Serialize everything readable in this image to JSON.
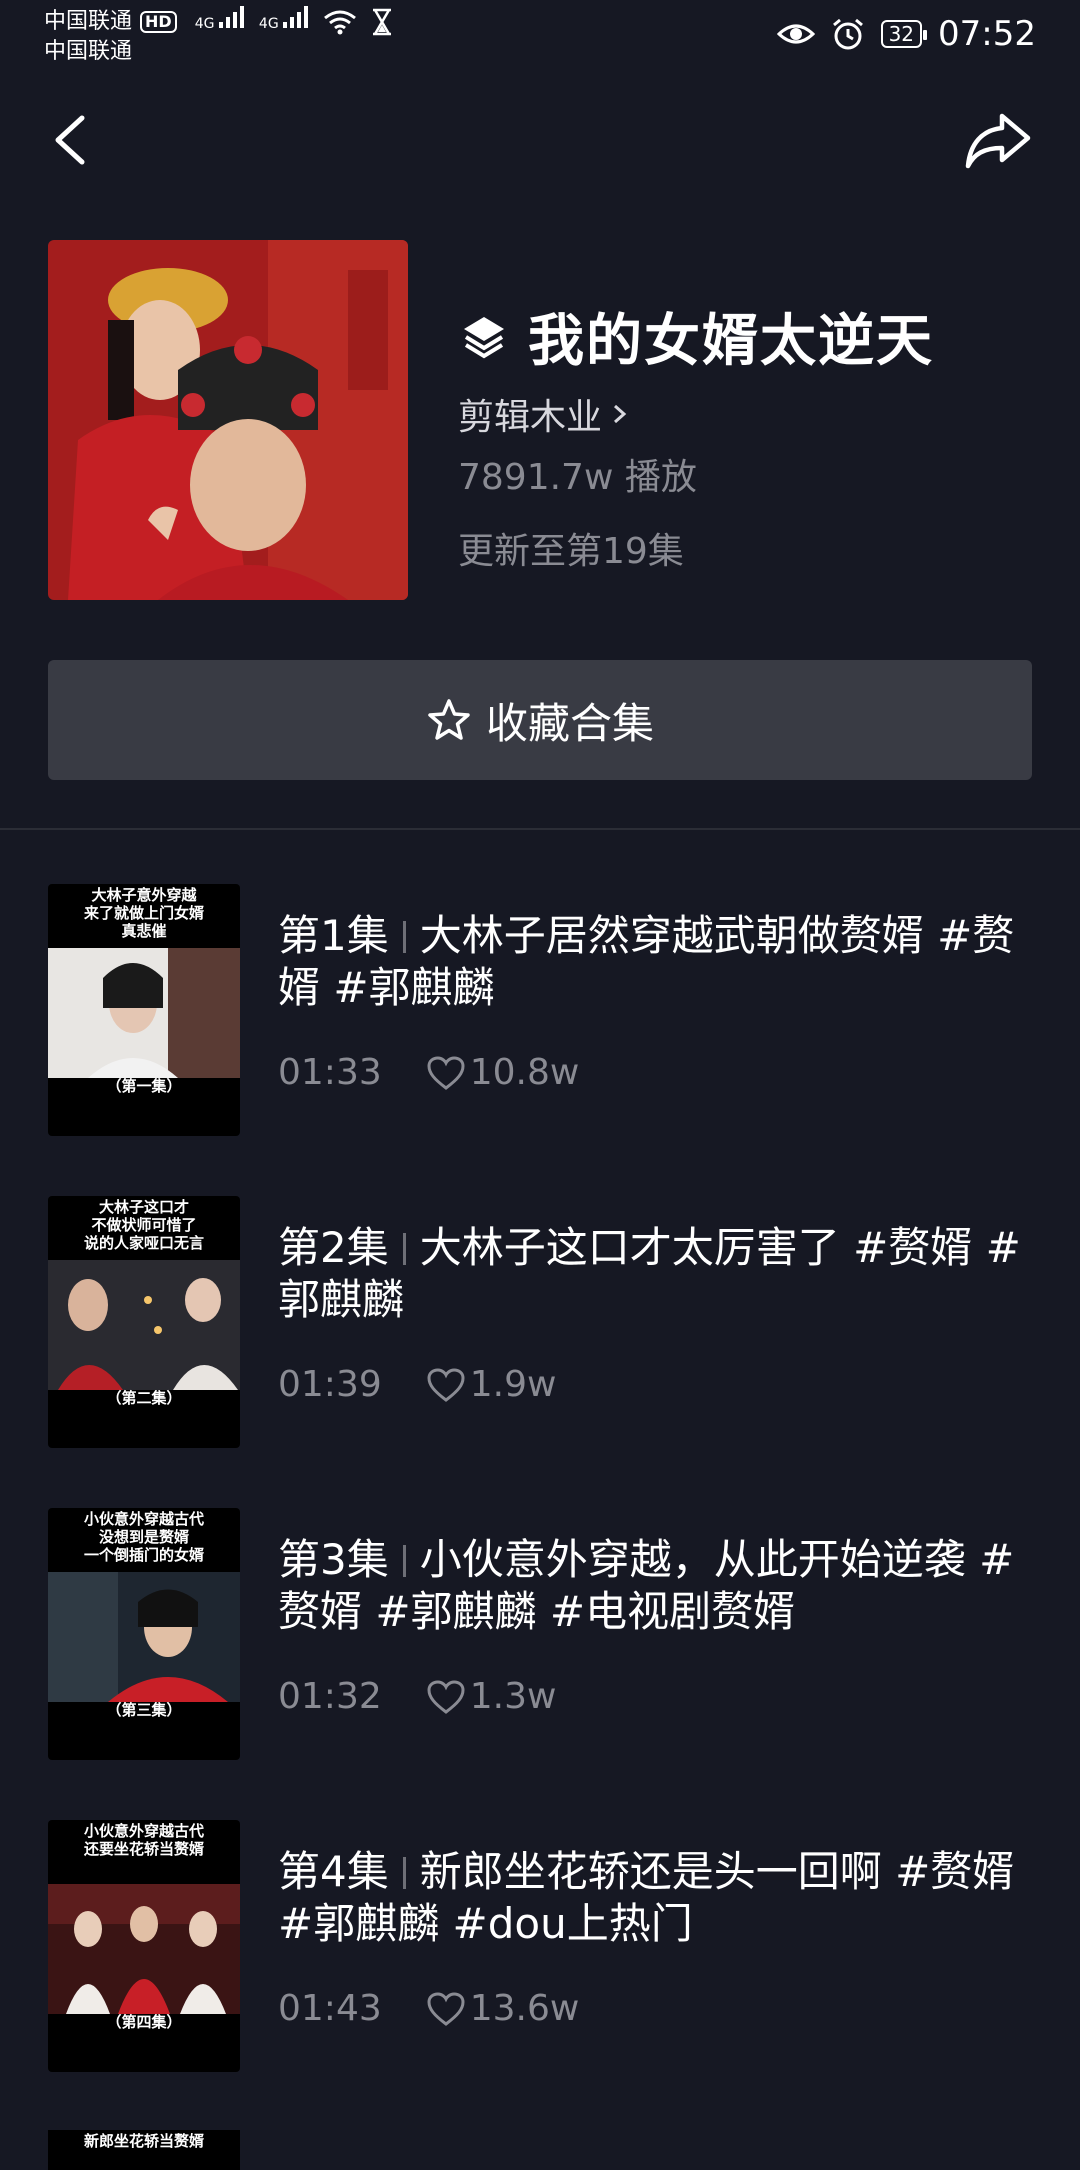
{
  "status": {
    "carrier1": "中国联通",
    "hd": "HD",
    "carrier2": "中国联通",
    "net1": "4G",
    "net2": "4G",
    "battery": "32",
    "time": "07:52"
  },
  "header": {
    "title": "我的女婿太逆天",
    "author": "剪辑木业",
    "plays": "7891.7w 播放",
    "update": "更新至第19集",
    "collect_label": "收藏合集"
  },
  "episodes": [
    {
      "num": "第1集",
      "title": "大林子居然穿越武朝做赘婿 #赘婿 #郭麒麟",
      "duration": "01:33",
      "likes": "10.8w",
      "thumb_caption": "大林子意外穿越\n来了就做上门女婿\n真悲催",
      "thumb_label": "（第一集）"
    },
    {
      "num": "第2集",
      "title": "大林子这口才太厉害了 #赘婿 #郭麒麟",
      "duration": "01:39",
      "likes": "1.9w",
      "thumb_caption": "大林子这口才\n不做状师可惜了\n说的人家哑口无言",
      "thumb_label": "（第二集）"
    },
    {
      "num": "第3集",
      "title": "小伙意外穿越，从此开始逆袭 #赘婿 #郭麒麟 #电视剧赘婿",
      "duration": "01:32",
      "likes": "1.3w",
      "thumb_caption": "小伙意外穿越古代\n没想到是赘婿\n一个倒插门的女婿",
      "thumb_label": "（第三集）"
    },
    {
      "num": "第4集",
      "title": "新郎坐花轿还是头一回啊 #赘婿 #郭麒麟 #dou上热门",
      "duration": "01:43",
      "likes": "13.6w",
      "thumb_caption": "小伙意外穿越古代\n还要坐花轿当赘婿",
      "thumb_label": "（第四集）"
    }
  ],
  "partial_caption": "新郎坐花轿当赘婿",
  "colors": {
    "background": "#161823",
    "button": "#393b44",
    "secondary_text": "#8a8b93"
  }
}
